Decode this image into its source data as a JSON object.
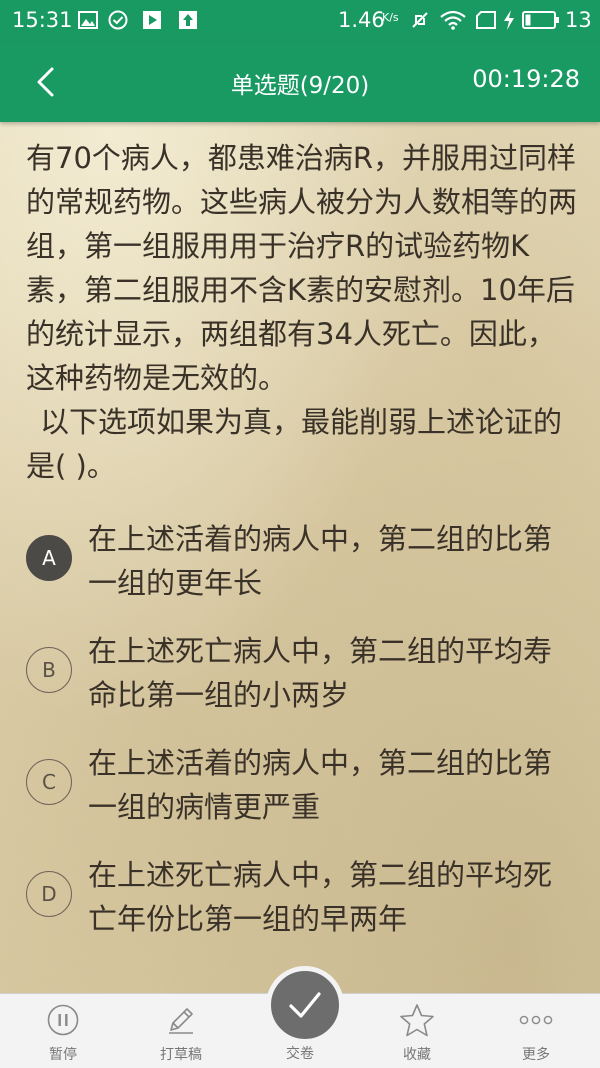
{
  "status_bar": {
    "time": "15:31",
    "speed": "1.46",
    "speed_unit": "K/s",
    "battery_level": "13"
  },
  "header": {
    "title": "单选题(9/20)",
    "timer": "00:19:28"
  },
  "question": {
    "paragraph_1": "有70个病人，都患难治病R，并服用过同样的常规药物。这些病人被分为人数相等的两组，第一组服用用于治疗R的试验药物K素，第二组服用不含K素的安慰剂。10年后的统计显示，两组都有34人死亡。因此，这种药物是无效的。",
    "paragraph_2": "以下选项如果为真，最能削弱上述论证的是(  )。"
  },
  "options": [
    {
      "letter": "A",
      "text": "在上述活着的病人中，第二组的比第一组的更年长",
      "selected": true
    },
    {
      "letter": "B",
      "text": "在上述死亡病人中，第二组的平均寿命比第一组的小两岁",
      "selected": false
    },
    {
      "letter": "C",
      "text": "在上述活着的病人中，第二组的比第一组的病情更严重",
      "selected": false
    },
    {
      "letter": "D",
      "text": "在上述死亡病人中，第二组的平均死亡年份比第一组的早两年",
      "selected": false
    }
  ],
  "bottom_bar": {
    "pause": "暂停",
    "draft": "打草稿",
    "submit": "交卷",
    "favorite": "收藏",
    "more": "更多"
  },
  "colors": {
    "primary_green": "#1a9a63",
    "selected_option": "#4c4a47",
    "submit_button": "#6d6d6d"
  },
  "icons": {
    "back": "chevron-left-icon",
    "pause": "pause-circle-icon",
    "draft": "pencil-icon",
    "submit": "checkmark-icon",
    "favorite": "star-icon",
    "more": "ellipsis-icon"
  }
}
